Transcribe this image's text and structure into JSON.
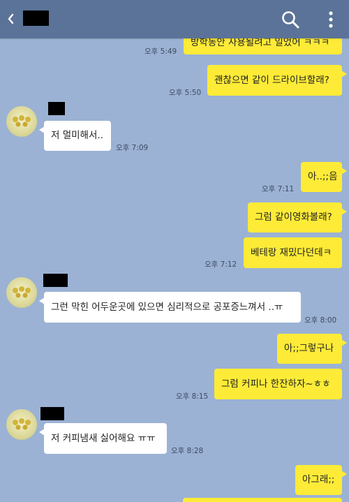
{
  "colors": {
    "background": "#9bb2d4",
    "header": "#5b7398",
    "my_bubble": "#fdeb37",
    "their_bubble": "#ffffff"
  },
  "header": {
    "back_icon": "chevron-left-icon",
    "search_icon": "search-icon",
    "menu_icon": "more-vertical-icon"
  },
  "messages": [
    {
      "text": "방학동안 사용될려고 일었어 ㅋㅋㅋ",
      "time": "오후 5:49"
    },
    {
      "text": "괜찮으면 같이 드라이브할래?",
      "time": "오후 5:50"
    },
    {
      "text": "저 멀미해서..",
      "time": "오후 7:09"
    },
    {
      "text": "아..;;음",
      "time": "오후 7:11"
    },
    {
      "text": "그럼 같이영화볼래?"
    },
    {
      "text": "베테랑 재밌다던데ㅋ",
      "time": "오후 7:12"
    },
    {
      "text": "그런 막힌 어두운곳에 있으면 심리적으로 공포증느껴서 ..ㅠ",
      "time": "오후 8:00"
    },
    {
      "text": "아;;그렇구나"
    },
    {
      "text": "그럼 커피나 한잔하자~ㅎㅎ",
      "time": "오후 8:15"
    },
    {
      "text": "저 커피냄새 싫어해요 ㅠㅠ",
      "time": "오후 8:28"
    },
    {
      "text": "아그래;;"
    }
  ]
}
